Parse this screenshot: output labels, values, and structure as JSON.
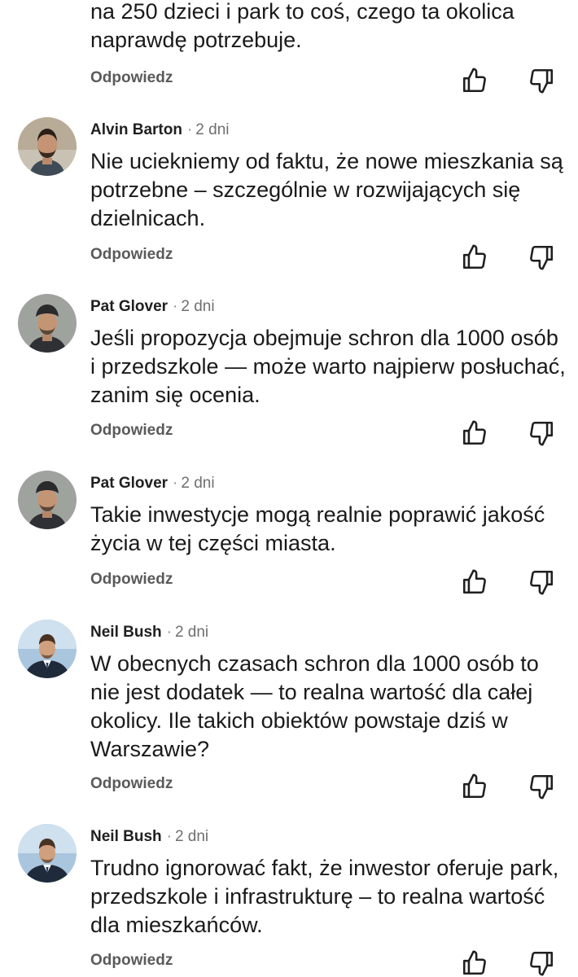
{
  "comments": [
    {
      "partial": true,
      "lines": [
        "na 250 dzieci i park to coś, czego ta okolica",
        "naprawdę potrzebuje."
      ],
      "reply_label": "Odpowiedz"
    },
    {
      "author": "Alvin Barton",
      "time": "2 dni",
      "avatar_icon": "man-beard-portrait",
      "lines": [
        "Nie uciekniemy od faktu, że nowe mieszkania są",
        "potrzebne – szczególnie w rozwijających się",
        "dzielnicach."
      ],
      "reply_label": "Odpowiedz"
    },
    {
      "author": "Pat Glover",
      "time": "2 dni",
      "avatar_icon": "man-cap-portrait",
      "lines": [
        "Jeśli propozycja obejmuje schron dla 1000 osób",
        "i przedszkole — może warto najpierw posłuchać,",
        "zanim się ocenia."
      ],
      "reply_label": "Odpowiedz"
    },
    {
      "author": "Pat Glover",
      "time": "2 dni",
      "avatar_icon": "man-cap-portrait",
      "lines": [
        "Takie inwestycje mogą realnie poprawić jakość",
        "życia w tej części miasta."
      ],
      "reply_label": "Odpowiedz"
    },
    {
      "author": "Neil Bush",
      "time": "2 dni",
      "avatar_icon": "businessman-portrait",
      "lines": [
        "W obecnych czasach schron dla 1000 osób to",
        "nie jest dodatek — to realna wartość dla całej",
        "okolicy. Ile takich obiektów powstaje dziś w",
        "Warszawie?"
      ],
      "reply_label": "Odpowiedz"
    },
    {
      "author": "Neil Bush",
      "time": "2 dni",
      "avatar_icon": "businessman-portrait",
      "lines": [
        "Trudno ignorować fakt, że inwestor oferuje park,",
        "przedszkole i infrastrukturę – to realna wartość",
        "dla mieszkańców."
      ],
      "reply_label": "Odpowiedz"
    }
  ],
  "icons": {
    "like": "thumbs-up-outline-icon",
    "dislike": "thumbs-down-outline-icon",
    "separator": "·"
  },
  "colors": {
    "text": "#1a1a1a",
    "muted": "#6f6f6f",
    "reply": "#5a5a5a",
    "icon": "#1f1f1f"
  }
}
